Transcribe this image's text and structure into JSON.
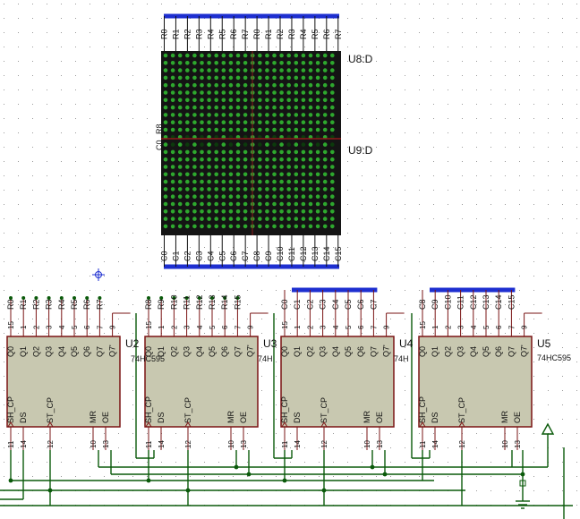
{
  "matrix": {
    "top_ref": "U8:D",
    "bottom_ref": "U9:D",
    "top_pin_labels": [
      "R0",
      "R1",
      "R2",
      "R3",
      "R4",
      "R5",
      "R6",
      "R7",
      "R0",
      "R1",
      "R2",
      "R3",
      "R4",
      "R5",
      "R6",
      "R7"
    ],
    "bottom_pin_labels": [
      "C0",
      "C1",
      "C2",
      "C3",
      "C4",
      "C5",
      "C6",
      "C7",
      "C8",
      "C9",
      "C10",
      "C11",
      "C12",
      "C13",
      "C14",
      "C15"
    ],
    "mid_left_labels": [
      "R8",
      "C0"
    ],
    "led_on_color": "#2ea82e",
    "led_off_color": "#0c3a0c",
    "body_color": "#141414",
    "split_line_color": "#8b1a1a"
  },
  "chips": [
    {
      "ref": "U2",
      "part": "",
      "top_pin_numbers": [
        "15",
        "1",
        "2",
        "3",
        "4",
        "5",
        "6",
        "7",
        "9"
      ],
      "bus_labels": [
        "R0",
        "R1",
        "R2",
        "R3",
        "R4",
        "R5",
        "R6",
        "R7"
      ],
      "pin_names_top": [
        "Q0",
        "Q1",
        "Q2",
        "Q3",
        "Q4",
        "Q5",
        "Q6",
        "Q7",
        "Q7'"
      ],
      "pin_names_bottom": [
        "SH_CP",
        "DS",
        "ST_CP",
        "MR",
        "OE"
      ],
      "bottom_pin_numbers": [
        "11",
        "14",
        "12",
        "10",
        "13"
      ],
      "bus_style": "dots"
    },
    {
      "ref": "U3",
      "part": "",
      "top_pin_numbers": [
        "15",
        "1",
        "2",
        "3",
        "4",
        "5",
        "6",
        "7",
        "9"
      ],
      "bus_labels": [
        "R8",
        "R9",
        "R10",
        "R11",
        "R12",
        "R13",
        "R14",
        "R15"
      ],
      "pin_names_top": [
        "Q0",
        "Q1",
        "Q2",
        "Q3",
        "Q4",
        "Q5",
        "Q6",
        "Q7",
        "Q7'"
      ],
      "pin_names_bottom": [
        "SH_CP",
        "DS",
        "ST_CP",
        "MR",
        "OE"
      ],
      "bottom_pin_numbers": [
        "11",
        "14",
        "12",
        "10",
        "13"
      ],
      "bus_style": "dots"
    },
    {
      "ref": "U4",
      "part": "",
      "top_pin_numbers": [
        "15",
        "1",
        "2",
        "3",
        "4",
        "5",
        "6",
        "7",
        "9"
      ],
      "bus_labels": [
        "C0",
        "C1",
        "C2",
        "C3",
        "C4",
        "C5",
        "C6",
        "C7"
      ],
      "pin_names_top": [
        "Q0",
        "Q1",
        "Q2",
        "Q3",
        "Q4",
        "Q5",
        "Q6",
        "Q7",
        "Q7'"
      ],
      "pin_names_bottom": [
        "SH_CP",
        "DS",
        "ST_CP",
        "MR",
        "OE"
      ],
      "bottom_pin_numbers": [
        "11",
        "14",
        "12",
        "10",
        "13"
      ],
      "bus_style": "bar"
    },
    {
      "ref": "U5",
      "part": "74HC595",
      "top_pin_numbers": [
        "15",
        "1",
        "2",
        "3",
        "4",
        "5",
        "6",
        "7",
        "9"
      ],
      "bus_labels": [
        "C8",
        "C9",
        "C10",
        "C11",
        "C12",
        "C13",
        "C14",
        "C15"
      ],
      "pin_names_top": [
        "Q0",
        "Q1",
        "Q2",
        "Q3",
        "Q4",
        "Q5",
        "Q6",
        "Q7",
        "Q7'"
      ],
      "pin_names_bottom": [
        "SH_CP",
        "DS",
        "ST_CP",
        "MR",
        "OE"
      ],
      "bottom_pin_numbers": [
        "11",
        "14",
        "12",
        "10",
        "13"
      ],
      "bus_style": "bar"
    }
  ],
  "overlap_labels": [
    {
      "text": "74HC595"
    },
    {
      "text": "74H"
    },
    {
      "text": "74H"
    }
  ],
  "colors": {
    "bus": "#1e2fd0",
    "wire": "#0a5a0a",
    "chip_fill": "#c8c8b0",
    "chip_stroke": "#7a1414",
    "pin": "#7a1414",
    "text": "#111111",
    "grid_dot": "#9a9a9a"
  }
}
